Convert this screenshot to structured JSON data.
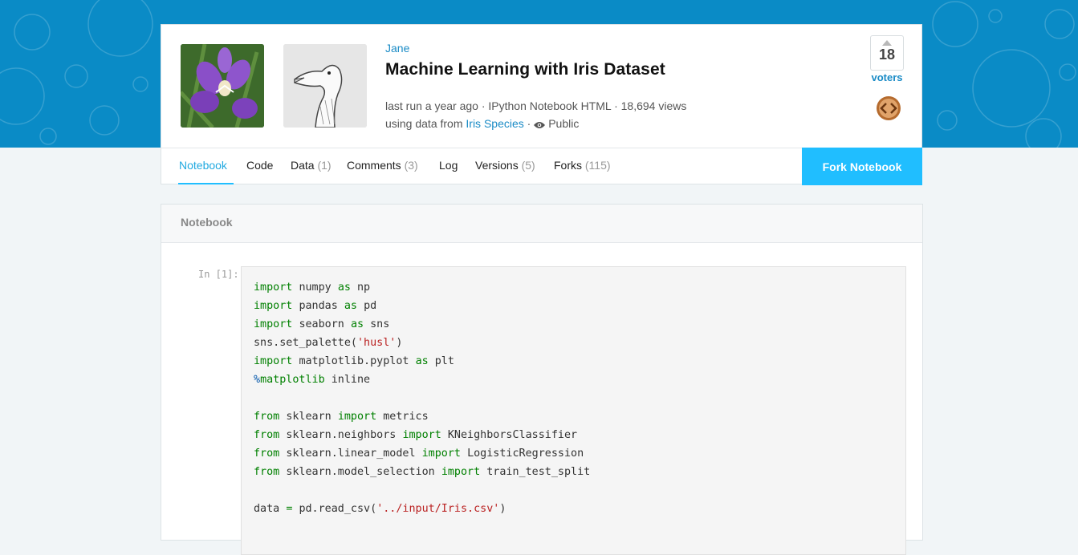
{
  "header": {
    "author": "Jane",
    "title": "Machine Learning with Iris Dataset",
    "meta_line1": "last run a year ago · IPython Notebook HTML · 18,694 views",
    "meta_line2_prefix": "using data from ",
    "dataset_link": "Iris Species",
    "meta_line2_sep": " · ",
    "visibility": "Public",
    "vote_count": "18",
    "voters_label": "voters"
  },
  "tabs": [
    {
      "label": "Notebook",
      "count": ""
    },
    {
      "label": "Code",
      "count": ""
    },
    {
      "label": "Data",
      "count": "(1)"
    },
    {
      "label": "Comments",
      "count": "(3)"
    },
    {
      "label": "Log",
      "count": ""
    },
    {
      "label": "Versions",
      "count": "(5)"
    },
    {
      "label": "Forks",
      "count": "(115)"
    }
  ],
  "fork_button": "Fork Notebook",
  "notebook": {
    "section_title": "Notebook",
    "prompt": "In [1]:",
    "code_lines": [
      [
        [
          "kw",
          "import"
        ],
        [
          "",
          "numpy"
        ],
        [
          "kw",
          "as"
        ],
        [
          "",
          "np"
        ]
      ],
      [
        [
          "kw",
          "import"
        ],
        [
          "",
          "pandas"
        ],
        [
          "kw",
          "as"
        ],
        [
          "",
          "pd"
        ]
      ],
      [
        [
          "kw",
          "import"
        ],
        [
          "",
          "seaborn"
        ],
        [
          "kw",
          "as"
        ],
        [
          "",
          "sns"
        ]
      ],
      [
        [
          "",
          "sns.set_palette("
        ],
        [
          "str",
          "'husl'"
        ],
        [
          ")",
          ")"
        ]
      ],
      [
        [
          "kw",
          "import"
        ],
        [
          "",
          "matplotlib.pyplot"
        ],
        [
          "kw",
          "as"
        ],
        [
          "",
          "plt"
        ]
      ],
      [
        [
          "mag",
          "%"
        ],
        [
          "kw",
          "matplotlib"
        ],
        [
          "",
          "inline"
        ]
      ],
      [],
      [
        [
          "kw",
          "from"
        ],
        [
          "",
          "sklearn"
        ],
        [
          "kw",
          "import"
        ],
        [
          "",
          "metrics"
        ]
      ],
      [
        [
          "kw",
          "from"
        ],
        [
          "",
          "sklearn.neighbors"
        ],
        [
          "kw",
          "import"
        ],
        [
          "",
          "KNeighborsClassifier"
        ]
      ],
      [
        [
          "kw",
          "from"
        ],
        [
          "",
          "sklearn.linear_model"
        ],
        [
          "kw",
          "import"
        ],
        [
          "",
          "LogisticRegression"
        ]
      ],
      [
        [
          "kw",
          "from"
        ],
        [
          "",
          "sklearn.model_selection"
        ],
        [
          "kw",
          "import"
        ],
        [
          "",
          "train_test_split"
        ]
      ],
      [],
      [
        [
          "",
          "data"
        ],
        [
          "kw",
          "="
        ],
        [
          "",
          "pd.read_csv("
        ],
        [
          "str",
          "'../input/Iris.csv'"
        ],
        [
          ")",
          ")"
        ]
      ]
    ]
  },
  "colors": {
    "hero_blue": "#0a8bc6",
    "accent": "#20beff",
    "link": "#1a8bc6",
    "keyword": "#008000",
    "string": "#ba2121"
  }
}
